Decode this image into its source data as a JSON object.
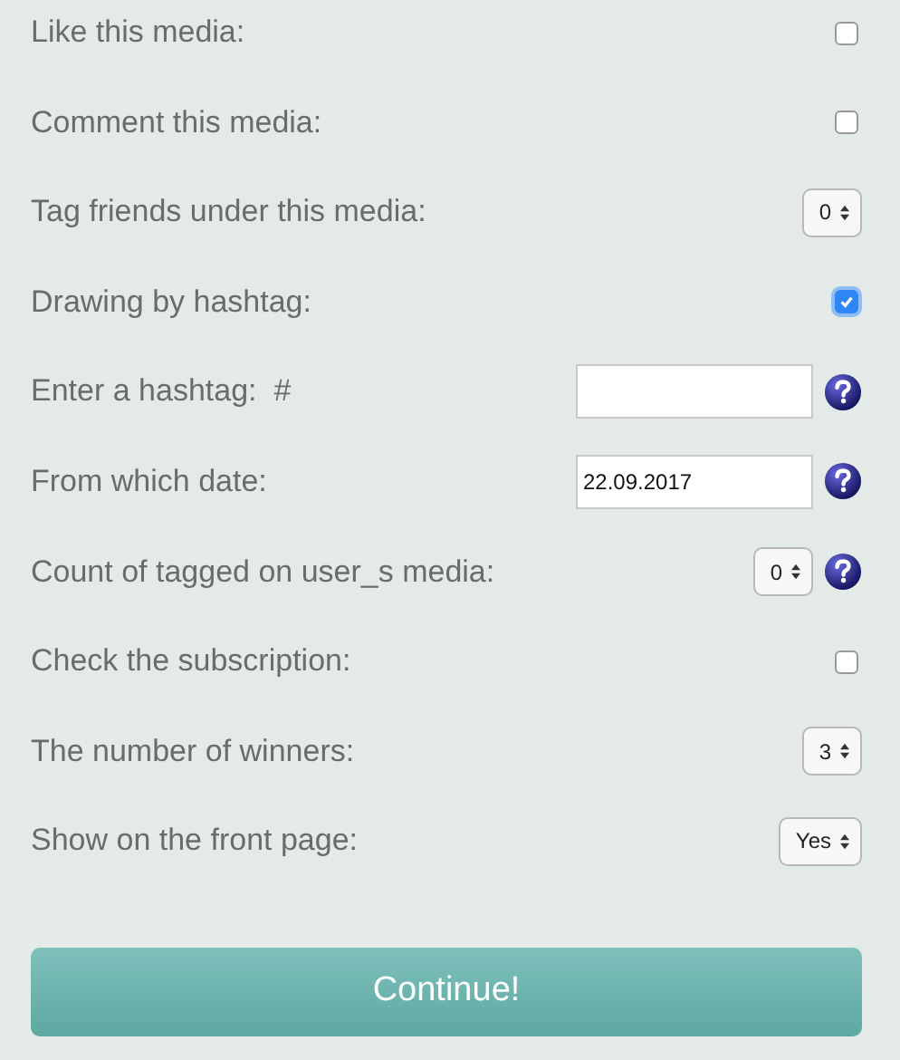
{
  "fields": [
    {
      "label": "Like this media:",
      "kind": "checkbox",
      "checked": false,
      "help": false
    },
    {
      "label": "Comment this media:",
      "kind": "checkbox",
      "checked": false,
      "help": false
    },
    {
      "label": "Tag friends under this media:",
      "kind": "select",
      "value": "0",
      "help": false
    },
    {
      "label": "Drawing by hashtag:",
      "kind": "checkbox",
      "checked": true,
      "help": false
    },
    {
      "label": "Enter a hashtag:  #",
      "kind": "text",
      "help": true
    },
    {
      "label": "From which date:",
      "kind": "text",
      "value": "22.09.2017",
      "help": true
    },
    {
      "label": "Count of tagged on user_s media:",
      "kind": "select",
      "value": "0",
      "help": true
    },
    {
      "label": "Check the subscription:",
      "kind": "checkbox",
      "checked": false,
      "help": false
    },
    {
      "label": "The number of winners:",
      "kind": "select",
      "value": "3",
      "help": false
    },
    {
      "label": "Show on the front page:",
      "kind": "select",
      "value": "Yes",
      "help": false
    }
  ],
  "submit": "Continue!"
}
